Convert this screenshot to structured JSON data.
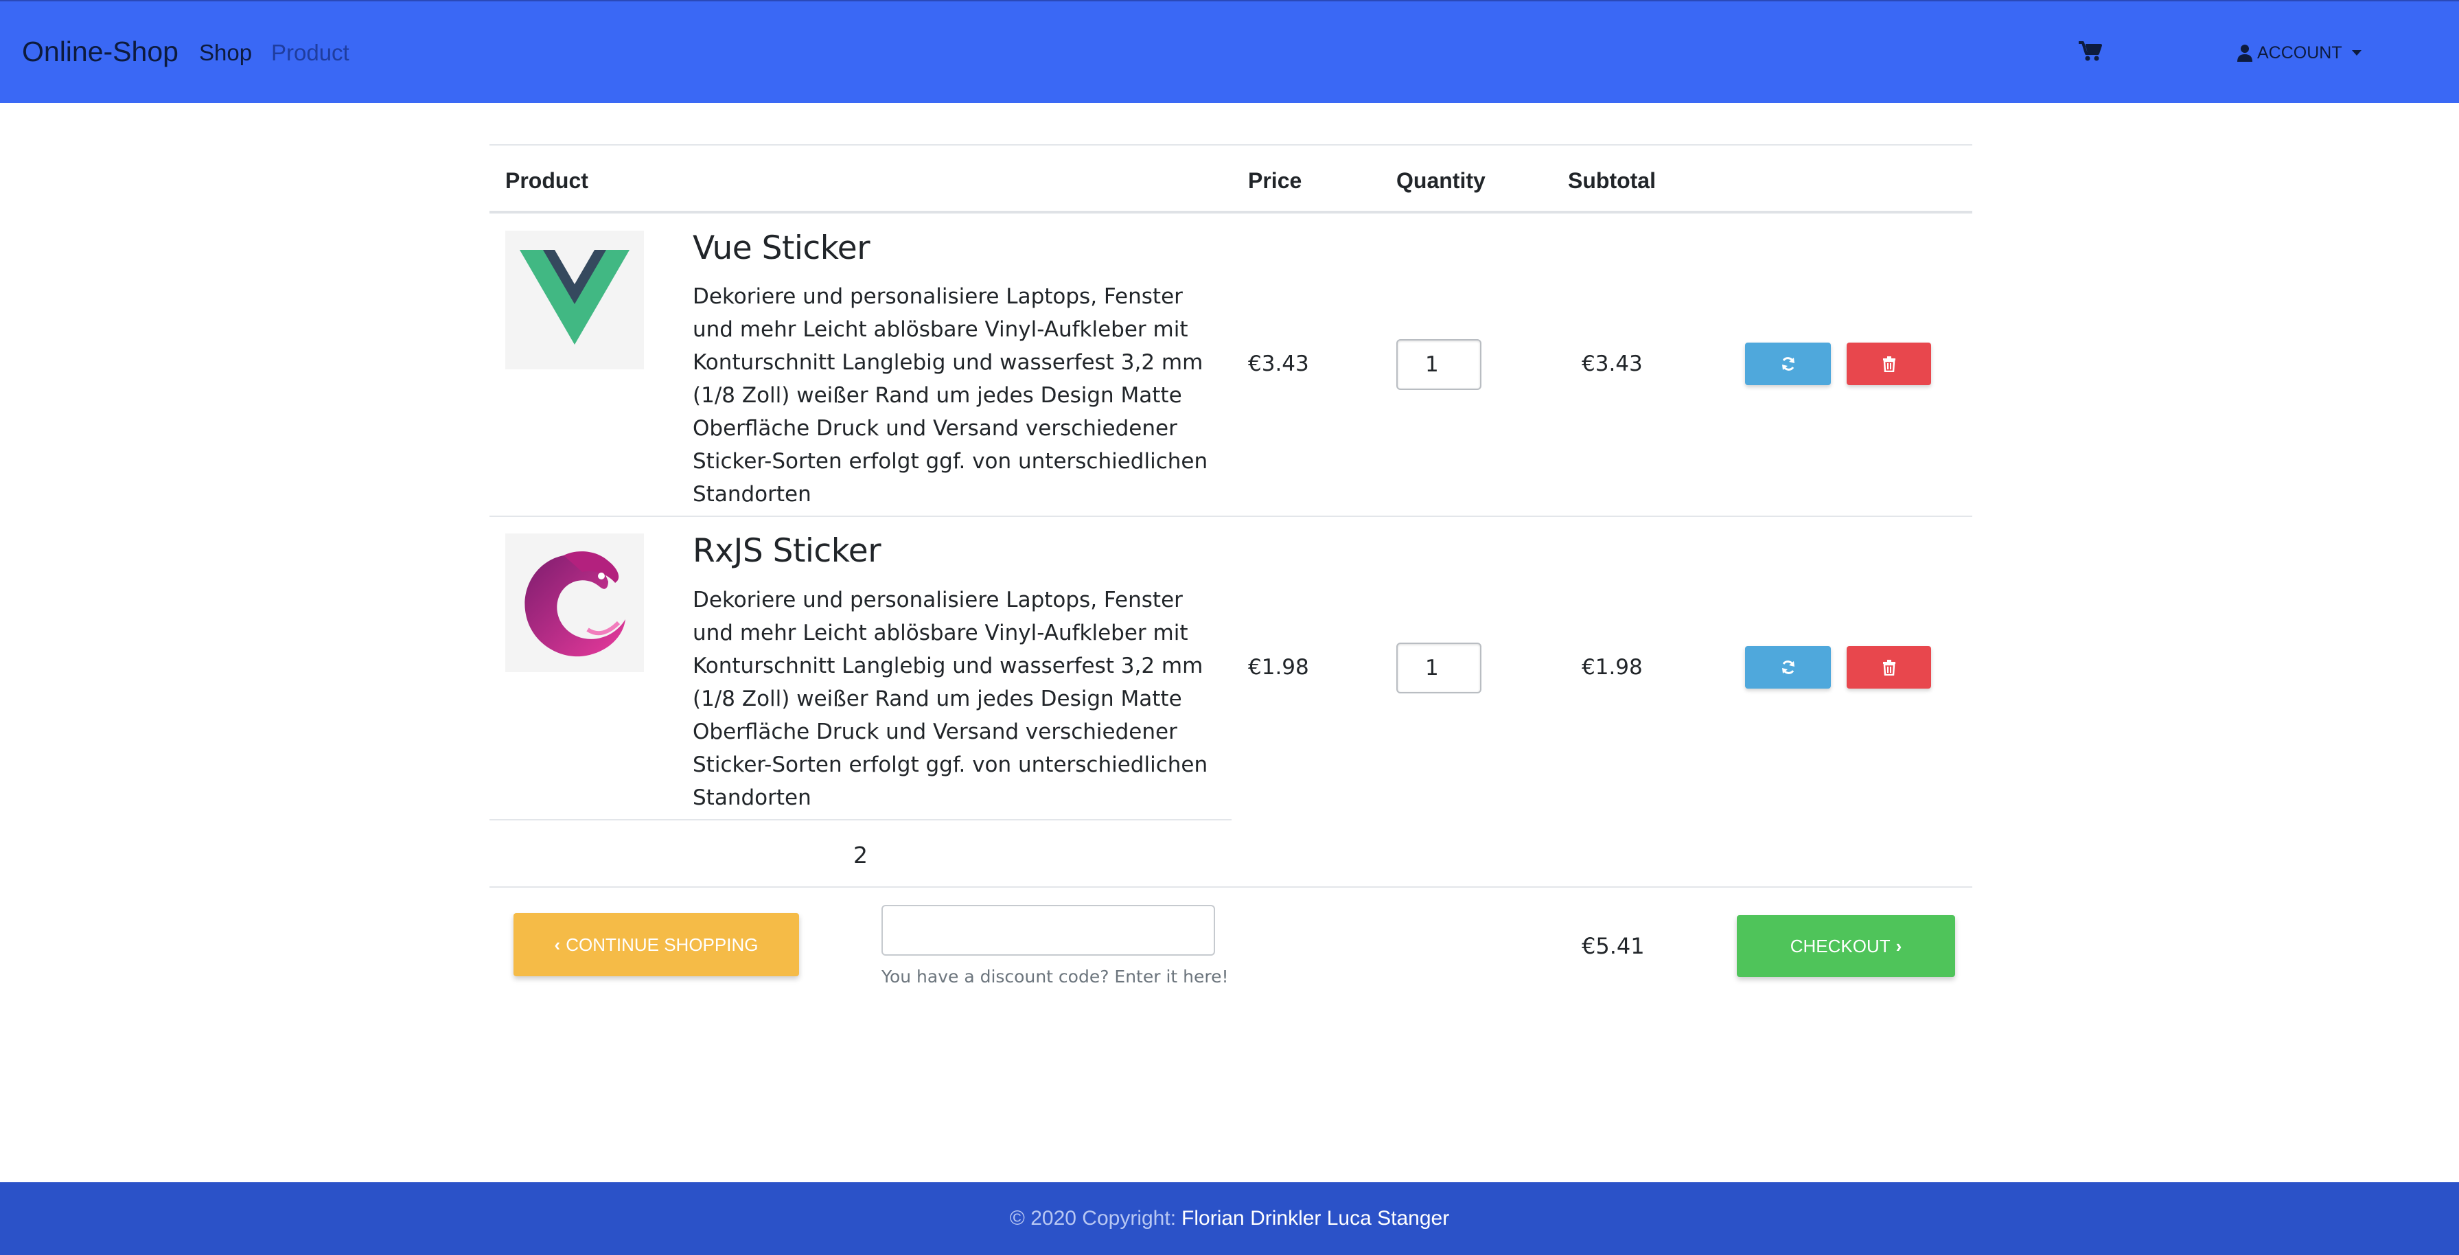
{
  "navbar": {
    "brand": "Online-Shop",
    "links": [
      {
        "label": "Shop"
      },
      {
        "label": "Product"
      }
    ],
    "cart_icon": "cart-icon",
    "account_label": "ACCOUNT",
    "colors": {
      "background": "#3a68f5"
    }
  },
  "table": {
    "headers": {
      "product": "Product",
      "price": "Price",
      "quantity": "Quantity",
      "subtotal": "Subtotal"
    },
    "rows": [
      {
        "title": "Vue Sticker",
        "description": "Dekoriere und personalisiere Laptops, Fenster und mehr Leicht ablösbare Vinyl-Aufkleber mit Konturschnitt Langlebig und wasserfest 3,2 mm (1/8 Zoll) weißer Rand um jedes Design Matte Oberfläche Druck und Versand verschiedener Sticker-Sorten erfolgt ggf. von unterschiedlichen Standorten",
        "image_icon": "vue-logo-icon",
        "price": "€3.43",
        "quantity": "1",
        "subtotal": "€3.43"
      },
      {
        "title": "RxJS Sticker",
        "description": "Dekoriere und personalisiere Laptops, Fenster und mehr Leicht ablösbare Vinyl-Aufkleber mit Konturschnitt Langlebig und wasserfest 3,2 mm (1/8 Zoll) weißer Rand um jedes Design Matte Oberfläche Druck und Versand verschiedener Sticker-Sorten erfolgt ggf. von unterschiedlichen Standorten",
        "image_icon": "rxjs-logo-icon",
        "price": "€1.98",
        "quantity": "1",
        "subtotal": "€1.98"
      }
    ],
    "item_count": "2"
  },
  "actions": {
    "continue_label": "CONTINUE SHOPPING",
    "discount_value": "",
    "discount_help": "You have a discount code? Enter it here!",
    "total": "€5.41",
    "checkout_label": "CHECKOUT",
    "colors": {
      "continue": "#f5bb47",
      "checkout": "#4fc45a",
      "refresh": "#4fa8dc",
      "delete": "#e8474d"
    }
  },
  "footer": {
    "copyright": "© 2020 Copyright:",
    "authors": "Florian Drinkler Luca Stanger",
    "colors": {
      "background": "#2b52c8"
    }
  }
}
